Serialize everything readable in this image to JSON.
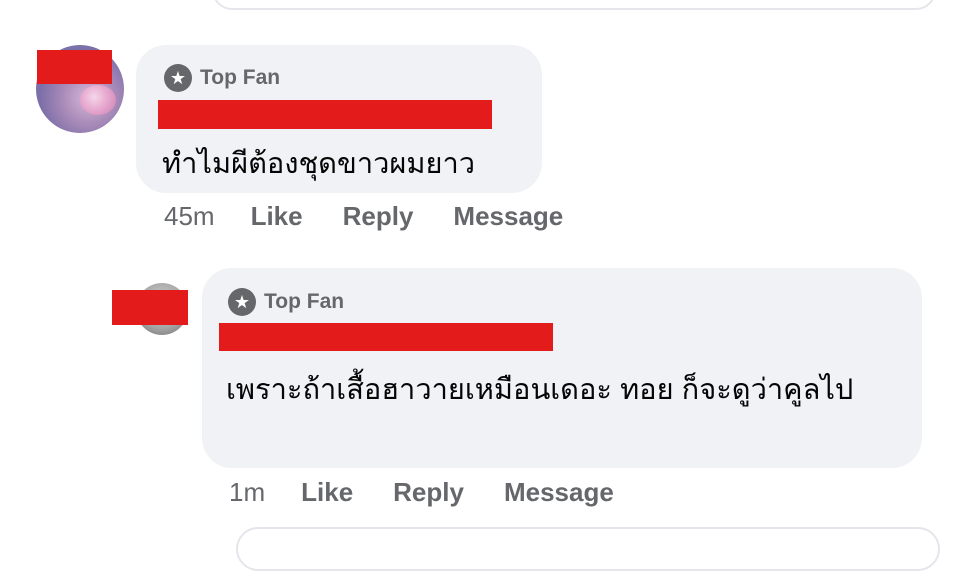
{
  "colors": {
    "bubble_bg": "#f0f2f5",
    "meta_text": "#65676b",
    "body_text": "#050505",
    "redaction": "#e31b1b"
  },
  "comments": [
    {
      "badge_icon": "star-icon",
      "badge_label": "Top Fan",
      "text": "ทำไมผีต้องชุดขาวผมยาว",
      "time": "45m",
      "like_label": "Like",
      "reply_label": "Reply",
      "message_label": "Message"
    },
    {
      "badge_icon": "star-icon",
      "badge_label": "Top Fan",
      "text": "เพราะถ้าเสื้อฮาวายเหมือนเดอะ ทอย ก็จะดูว่าคูลไป",
      "time": "1m",
      "like_label": "Like",
      "reply_label": "Reply",
      "message_label": "Message"
    }
  ]
}
